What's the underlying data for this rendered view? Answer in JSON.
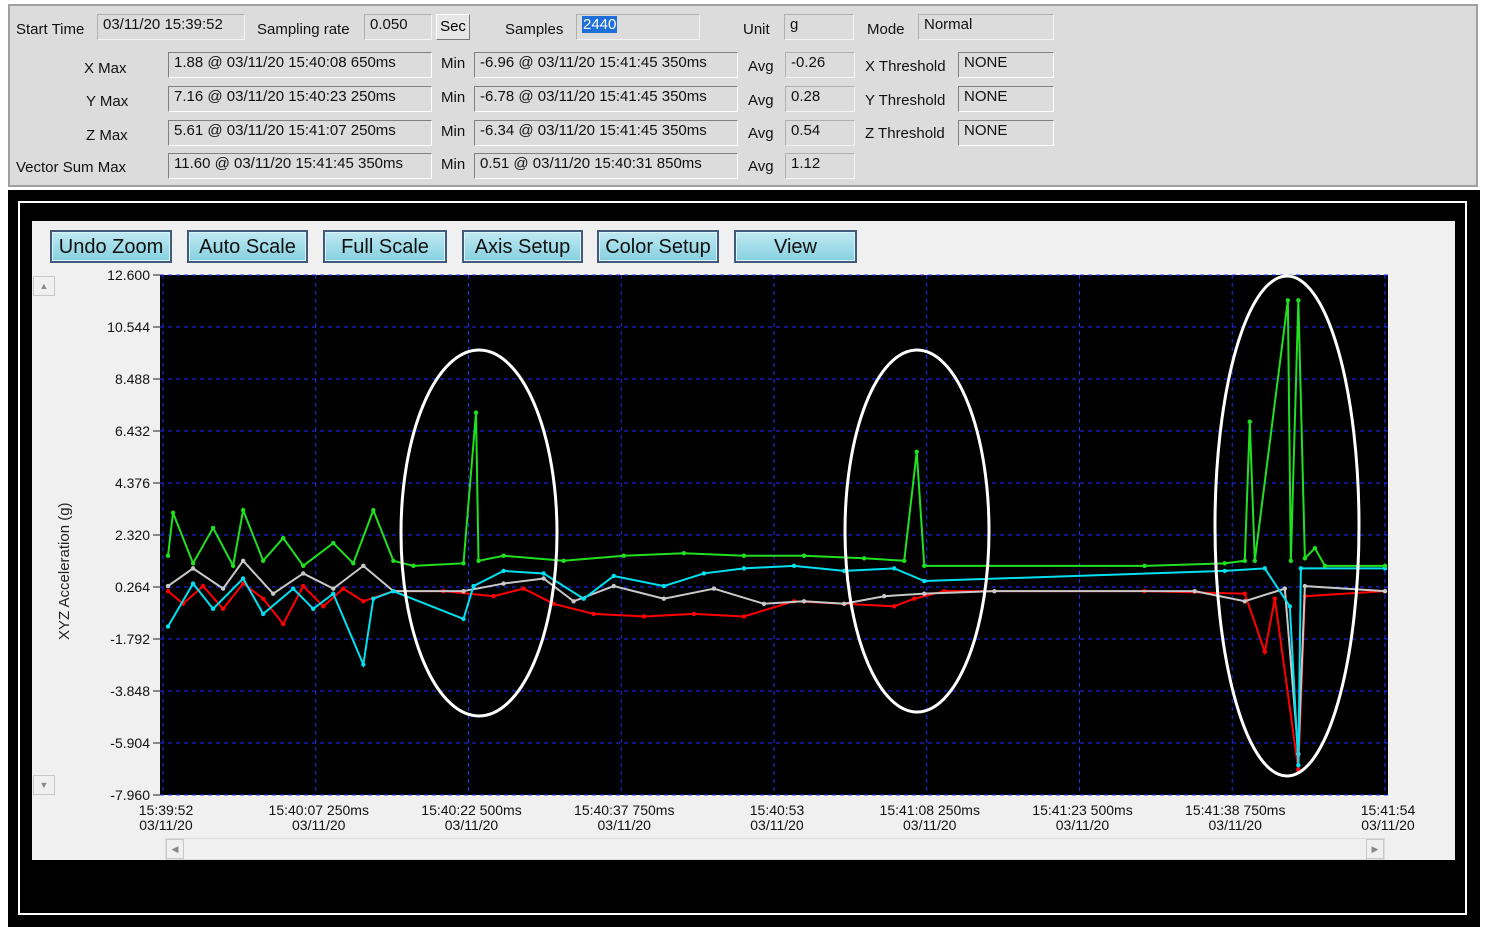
{
  "stats": {
    "start_time_label": "Start Time",
    "start_time": "03/11/20 15:39:52",
    "sampling_rate_label": "Sampling rate",
    "sampling_rate": "0.050",
    "sampling_unit_button": "Sec",
    "samples_label": "Samples",
    "samples": "2440",
    "unit_label": "Unit",
    "unit": "g",
    "mode_label": "Mode",
    "mode": "Normal",
    "min_label": "Min",
    "avg_label": "Avg",
    "rows": [
      {
        "label": "X  Max",
        "max": "1.88 @ 03/11/20 15:40:08 650ms",
        "min": "-6.96 @ 03/11/20 15:41:45 350ms",
        "avg": "-0.26",
        "threshold_label": "X Threshold",
        "threshold": "NONE"
      },
      {
        "label": "Y  Max",
        "max": "7.16 @ 03/11/20 15:40:23 250ms",
        "min": "-6.78 @ 03/11/20 15:41:45 350ms",
        "avg": "0.28",
        "threshold_label": "Y Threshold",
        "threshold": "NONE"
      },
      {
        "label": "Z  Max",
        "max": "5.61 @ 03/11/20 15:41:07 250ms",
        "min": "-6.34 @ 03/11/20 15:41:45 350ms",
        "avg": "0.54",
        "threshold_label": "Z Threshold",
        "threshold": "NONE"
      },
      {
        "label": "Vector Sum Max",
        "max": "11.60 @ 03/11/20 15:41:45 350ms",
        "min": "0.51 @ 03/11/20 15:40:31 850ms",
        "avg": "1.12"
      }
    ]
  },
  "toolbar": {
    "buttons": [
      "Undo Zoom",
      "Auto Scale",
      "Full Scale",
      "Axis Setup",
      "Color Setup",
      "View"
    ]
  },
  "chart_data": {
    "type": "line",
    "ylabel": "XYZ  Acceleration (g)",
    "ylim": [
      -7.96,
      12.6
    ],
    "yticks": [
      "12.600",
      "10.544",
      "8.488",
      "6.432",
      "4.376",
      "2.320",
      "0.264",
      "-1.792",
      "-3.848",
      "-5.904",
      "-7.960"
    ],
    "xlim": [
      "15:39:52",
      "15:41:54"
    ],
    "xticks": [
      {
        "t": "15:39:52",
        "l1": "15:39:52",
        "l2": "03/11/20"
      },
      {
        "t": "15:40:07.25",
        "l1": "15:40:07 250ms",
        "l2": "03/11/20"
      },
      {
        "t": "15:40:22.5",
        "l1": "15:40:22 500ms",
        "l2": "03/11/20"
      },
      {
        "t": "15:40:37.75",
        "l1": "15:40:37 750ms",
        "l2": "03/11/20"
      },
      {
        "t": "15:40:53",
        "l1": "15:40:53",
        "l2": "03/11/20"
      },
      {
        "t": "15:41:08.25",
        "l1": "15:41:08 250ms",
        "l2": "03/11/20"
      },
      {
        "t": "15:41:23.5",
        "l1": "15:41:23 500ms",
        "l2": "03/11/20"
      },
      {
        "t": "15:41:38.75",
        "l1": "15:41:38 750ms",
        "l2": "03/11/20"
      },
      {
        "t": "15:41:54",
        "l1": "15:41:54",
        "l2": "03/11/20"
      }
    ],
    "grid": true,
    "background": "#000000",
    "grid_color": "#2030ff",
    "series": [
      {
        "color": "#ff0000",
        "points": [
          [
            "15:39:52.5",
            0.1
          ],
          [
            "15:39:54",
            -0.4
          ],
          [
            "15:39:56",
            0.3
          ],
          [
            "15:39:58",
            -0.6
          ],
          [
            "15:40:00",
            0.4
          ],
          [
            "15:40:02",
            -0.2
          ],
          [
            "15:40:04",
            -1.2
          ],
          [
            "15:40:06",
            0.3
          ],
          [
            "15:40:08",
            -0.5
          ],
          [
            "15:40:10",
            0.2
          ],
          [
            "15:40:12",
            -0.3
          ],
          [
            "15:40:15",
            0.1
          ],
          [
            "15:40:20",
            0.1
          ],
          [
            "15:40:25",
            -0.1
          ],
          [
            "15:40:28",
            0.2
          ],
          [
            "15:40:31",
            -0.4
          ],
          [
            "15:40:35",
            -0.8
          ],
          [
            "15:40:40",
            -0.9
          ],
          [
            "15:40:45",
            -0.8
          ],
          [
            "15:40:50",
            -0.9
          ],
          [
            "15:40:55",
            -0.3
          ],
          [
            "15:41:00",
            -0.4
          ],
          [
            "15:41:05",
            -0.5
          ],
          [
            "15:41:07",
            -0.2
          ],
          [
            "15:41:10",
            0.1
          ],
          [
            "15:41:30",
            0.1
          ],
          [
            "15:41:40",
            0.0
          ],
          [
            "15:41:42",
            -2.3
          ],
          [
            "15:41:43",
            -0.2
          ],
          [
            "15:41:45.35",
            -6.96
          ],
          [
            "15:41:46",
            -0.1
          ],
          [
            "15:41:54",
            0.1
          ]
        ]
      },
      {
        "color": "#c8c8c8",
        "points": [
          [
            "15:39:52.5",
            0.3
          ],
          [
            "15:39:55",
            1.0
          ],
          [
            "15:39:58",
            0.2
          ],
          [
            "15:40:00",
            1.3
          ],
          [
            "15:40:03",
            0.0
          ],
          [
            "15:40:06",
            0.8
          ],
          [
            "15:40:09",
            0.2
          ],
          [
            "15:40:12",
            1.1
          ],
          [
            "15:40:15",
            0.1
          ],
          [
            "15:40:22",
            0.1
          ],
          [
            "15:40:26",
            0.4
          ],
          [
            "15:40:30",
            0.6
          ],
          [
            "15:40:33",
            -0.3
          ],
          [
            "15:40:37",
            0.3
          ],
          [
            "15:40:42",
            -0.2
          ],
          [
            "15:40:47",
            0.2
          ],
          [
            "15:40:52",
            -0.4
          ],
          [
            "15:40:56",
            -0.3
          ],
          [
            "15:41:00",
            -0.4
          ],
          [
            "15:41:04",
            -0.1
          ],
          [
            "15:41:08",
            0.0
          ],
          [
            "15:41:15",
            0.1
          ],
          [
            "15:41:35",
            0.1
          ],
          [
            "15:41:40",
            -0.3
          ],
          [
            "15:41:44",
            0.2
          ],
          [
            "15:41:45.35",
            -6.34
          ],
          [
            "15:41:46",
            0.3
          ],
          [
            "15:41:54",
            0.1
          ]
        ]
      },
      {
        "color": "#00e0f0",
        "points": [
          [
            "15:39:52.5",
            -1.3
          ],
          [
            "15:39:55",
            0.4
          ],
          [
            "15:39:57",
            -0.6
          ],
          [
            "15:40:00",
            0.6
          ],
          [
            "15:40:02",
            -0.8
          ],
          [
            "15:40:05",
            0.2
          ],
          [
            "15:40:07",
            -0.6
          ],
          [
            "15:40:09",
            0.0
          ],
          [
            "15:40:12",
            -2.8
          ],
          [
            "15:40:13",
            -0.2
          ],
          [
            "15:40:15",
            0.1
          ],
          [
            "15:40:22",
            -1.0
          ],
          [
            "15:40:23",
            0.3
          ],
          [
            "15:40:26",
            0.9
          ],
          [
            "15:40:30",
            0.8
          ],
          [
            "15:40:34",
            -0.2
          ],
          [
            "15:40:37",
            0.7
          ],
          [
            "15:40:42",
            0.3
          ],
          [
            "15:40:46",
            0.8
          ],
          [
            "15:40:50",
            1.0
          ],
          [
            "15:40:55",
            1.1
          ],
          [
            "15:41:00",
            0.9
          ],
          [
            "15:41:05",
            1.0
          ],
          [
            "15:41:08",
            0.5
          ],
          [
            "15:41:38",
            0.9
          ],
          [
            "15:41:42",
            1.0
          ],
          [
            "15:41:44.5",
            -0.5
          ],
          [
            "15:41:45.35",
            -6.78
          ],
          [
            "15:41:45.6",
            1.0
          ],
          [
            "15:41:54",
            1.0
          ]
        ]
      },
      {
        "color": "#20e020",
        "points": [
          [
            "15:39:52.5",
            1.5
          ],
          [
            "15:39:53",
            3.2
          ],
          [
            "15:39:55",
            1.2
          ],
          [
            "15:39:57",
            2.6
          ],
          [
            "15:39:59",
            1.1
          ],
          [
            "15:40:00",
            3.3
          ],
          [
            "15:40:02",
            1.3
          ],
          [
            "15:40:04",
            2.2
          ],
          [
            "15:40:06",
            1.1
          ],
          [
            "15:40:09",
            2.0
          ],
          [
            "15:40:11",
            1.2
          ],
          [
            "15:40:13",
            3.3
          ],
          [
            "15:40:15",
            1.3
          ],
          [
            "15:40:17",
            1.1
          ],
          [
            "15:40:22",
            1.2
          ],
          [
            "15:40:23.25",
            7.16
          ],
          [
            "15:40:23.5",
            1.3
          ],
          [
            "15:40:26",
            1.5
          ],
          [
            "15:40:32",
            1.3
          ],
          [
            "15:40:38",
            1.5
          ],
          [
            "15:40:44",
            1.6
          ],
          [
            "15:40:50",
            1.5
          ],
          [
            "15:40:56",
            1.5
          ],
          [
            "15:41:02",
            1.4
          ],
          [
            "15:41:06",
            1.3
          ],
          [
            "15:41:07.25",
            5.61
          ],
          [
            "15:41:08",
            1.1
          ],
          [
            "15:41:30",
            1.1
          ],
          [
            "15:41:38",
            1.2
          ],
          [
            "15:41:40",
            1.3
          ],
          [
            "15:41:40.5",
            6.8
          ],
          [
            "15:41:41",
            1.3
          ],
          [
            "15:41:44.3",
            11.6
          ],
          [
            "15:41:44.6",
            1.3
          ],
          [
            "15:41:45.35",
            11.6
          ],
          [
            "15:41:46",
            1.4
          ],
          [
            "15:41:47",
            1.8
          ],
          [
            "15:41:48",
            1.1
          ],
          [
            "15:41:54",
            1.1
          ]
        ]
      }
    ]
  }
}
